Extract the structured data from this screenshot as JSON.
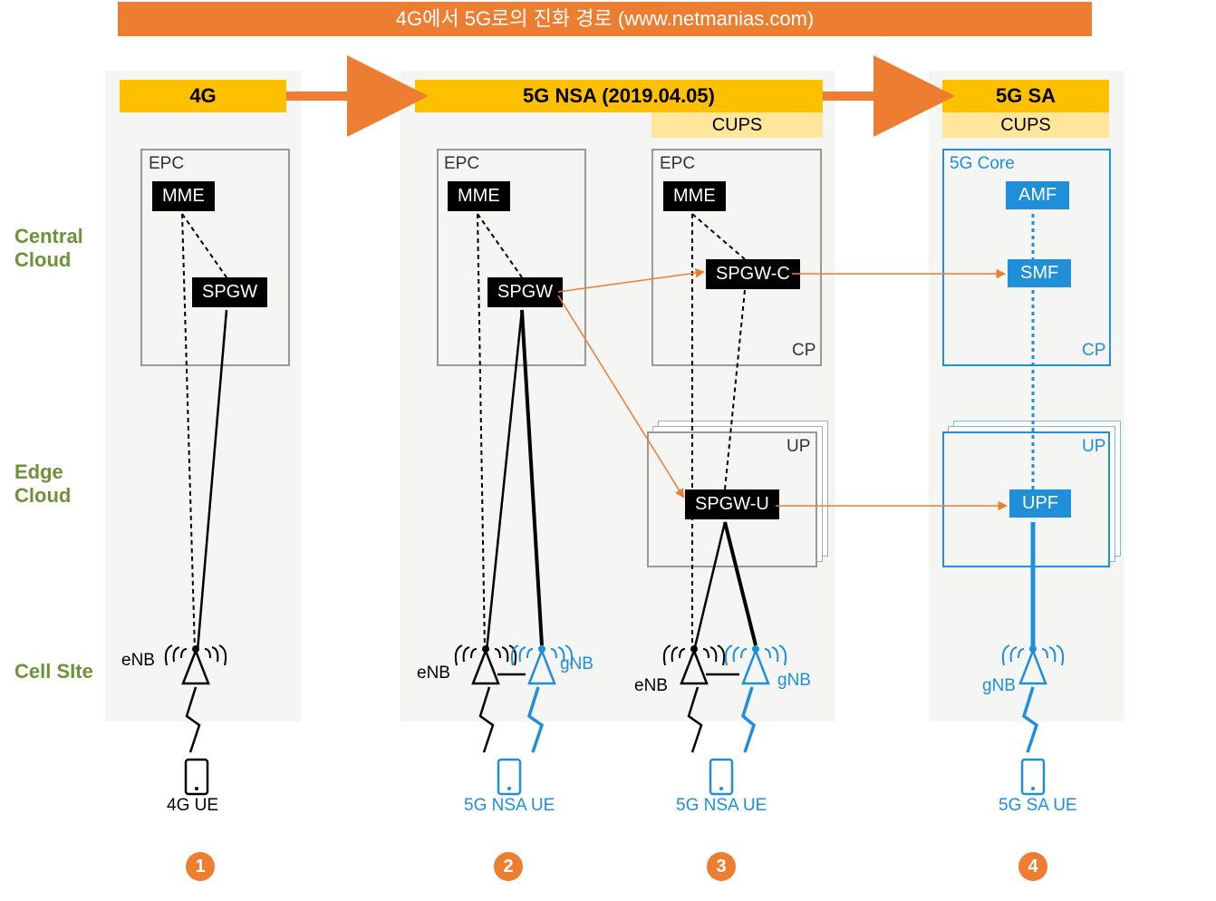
{
  "title": "4G에서 5G로의 진화 경로 (www.netmanias.com)",
  "row_labels": {
    "central": "Central\nCloud",
    "edge": "Edge\nCloud",
    "cell": "Cell SIte"
  },
  "stages": {
    "s4g": {
      "header": "4G",
      "epc": "EPC",
      "mme": "MME",
      "spgw": "SPGW",
      "enb": "eNB",
      "ue": "4G UE"
    },
    "nsa": {
      "header": "5G NSA (2019.04.05)",
      "cups": "CUPS",
      "left": {
        "epc": "EPC",
        "mme": "MME",
        "spgw": "SPGW",
        "enb": "eNB",
        "gnb": "gNB",
        "ue": "5G NSA UE"
      },
      "right": {
        "epc": "EPC",
        "mme": "MME",
        "spgwc": "SPGW-C",
        "spgwu": "SPGW-U",
        "cp": "CP",
        "up": "UP",
        "enb": "eNB",
        "gnb": "gNB",
        "ue": "5G NSA UE"
      }
    },
    "sa": {
      "header": "5G SA",
      "cups": "CUPS",
      "core": "5G Core",
      "amf": "AMF",
      "smf": "SMF",
      "upf": "UPF",
      "cp": "CP",
      "up": "UP",
      "gnb": "gNB",
      "ue": "5G SA UE"
    }
  },
  "steps": {
    "one": "1",
    "two": "2",
    "three": "3",
    "four": "4"
  }
}
